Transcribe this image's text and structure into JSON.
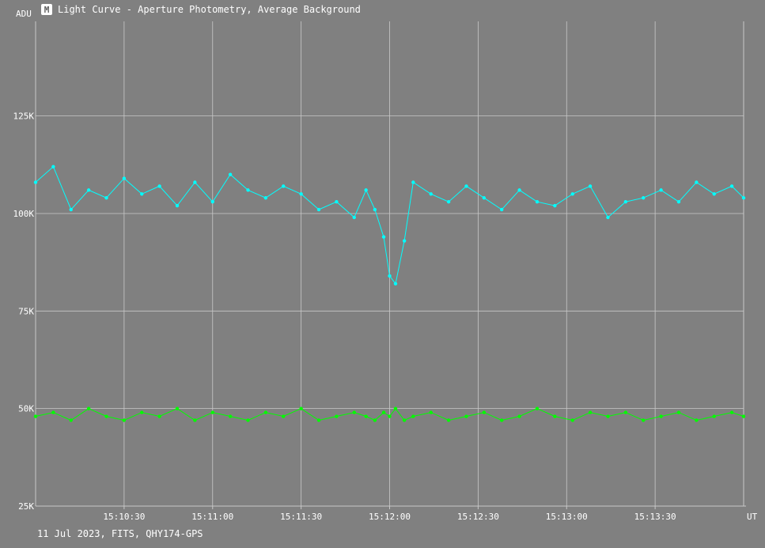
{
  "window": {
    "title": "Light Curve - Aperture Photometry, Average Background",
    "icon": "light-curve-app-icon"
  },
  "footer_text": "11 Jul 2023, FITS, QHY174-GPS",
  "colors": {
    "background": "#808080",
    "grid": "#c8c8c8",
    "target_series": "#00ffff",
    "background_series": "#00ff00",
    "text": "#ffffff"
  },
  "chart_data": {
    "type": "line",
    "title": "Light Curve - Aperture Photometry, Average Background",
    "xlabel": "UT",
    "ylabel": "ADU",
    "xlim": [
      "15:10:00",
      "15:14:00"
    ],
    "ylim": [
      25000,
      125000
    ],
    "y_ticks": [
      25000,
      50000,
      75000,
      100000,
      125000
    ],
    "y_tick_labels": [
      "25K",
      "50K",
      "75K",
      "100K",
      "125K"
    ],
    "x_ticks": [
      "15:10:30",
      "15:11:00",
      "15:11:30",
      "15:12:00",
      "15:12:30",
      "15:13:00",
      "15:13:30"
    ],
    "grid": true,
    "markers": "dots",
    "series": [
      {
        "x": [
          "15:10:00",
          "15:10:06",
          "15:10:12",
          "15:10:18",
          "15:10:24",
          "15:10:30",
          "15:10:36",
          "15:10:42",
          "15:10:48",
          "15:10:54",
          "15:11:00",
          "15:11:06",
          "15:11:12",
          "15:11:18",
          "15:11:24",
          "15:11:30",
          "15:11:36",
          "15:11:42",
          "15:11:48",
          "15:11:52",
          "15:11:55",
          "15:11:58",
          "15:12:00",
          "15:12:02",
          "15:12:05",
          "15:12:08",
          "15:12:14",
          "15:12:20",
          "15:12:26",
          "15:12:32",
          "15:12:38",
          "15:12:44",
          "15:12:50",
          "15:12:56",
          "15:13:02",
          "15:13:08",
          "15:13:14",
          "15:13:20",
          "15:13:26",
          "15:13:32",
          "15:13:38",
          "15:13:44",
          "15:13:50",
          "15:13:56",
          "15:14:00"
        ],
        "values": [
          108000,
          112000,
          101000,
          106000,
          104000,
          109000,
          105000,
          107000,
          102000,
          108000,
          103000,
          110000,
          106000,
          104000,
          107000,
          105000,
          101000,
          103000,
          99000,
          106000,
          101000,
          94000,
          84000,
          82000,
          93000,
          108000,
          105000,
          103000,
          107000,
          104000,
          101000,
          106000,
          103000,
          102000,
          105000,
          107000,
          99000,
          103000,
          104000,
          106000,
          103000,
          108000,
          105000,
          107000,
          104000
        ]
      },
      {
        "x": [
          "15:10:00",
          "15:10:06",
          "15:10:12",
          "15:10:18",
          "15:10:24",
          "15:10:30",
          "15:10:36",
          "15:10:42",
          "15:10:48",
          "15:10:54",
          "15:11:00",
          "15:11:06",
          "15:11:12",
          "15:11:18",
          "15:11:24",
          "15:11:30",
          "15:11:36",
          "15:11:42",
          "15:11:48",
          "15:11:52",
          "15:11:55",
          "15:11:58",
          "15:12:00",
          "15:12:02",
          "15:12:05",
          "15:12:08",
          "15:12:14",
          "15:12:20",
          "15:12:26",
          "15:12:32",
          "15:12:38",
          "15:12:44",
          "15:12:50",
          "15:12:56",
          "15:13:02",
          "15:13:08",
          "15:13:14",
          "15:13:20",
          "15:13:26",
          "15:13:32",
          "15:13:38",
          "15:13:44",
          "15:13:50",
          "15:13:56",
          "15:14:00"
        ],
        "values": [
          48000,
          49000,
          47000,
          50000,
          48000,
          47000,
          49000,
          48000,
          50000,
          47000,
          49000,
          48000,
          47000,
          49000,
          48000,
          50000,
          47000,
          48000,
          49000,
          48000,
          47000,
          49000,
          48000,
          50000,
          47000,
          48000,
          49000,
          47000,
          48000,
          49000,
          47000,
          48000,
          50000,
          48000,
          47000,
          49000,
          48000,
          49000,
          47000,
          48000,
          49000,
          47000,
          48000,
          49000,
          48000
        ]
      }
    ]
  }
}
